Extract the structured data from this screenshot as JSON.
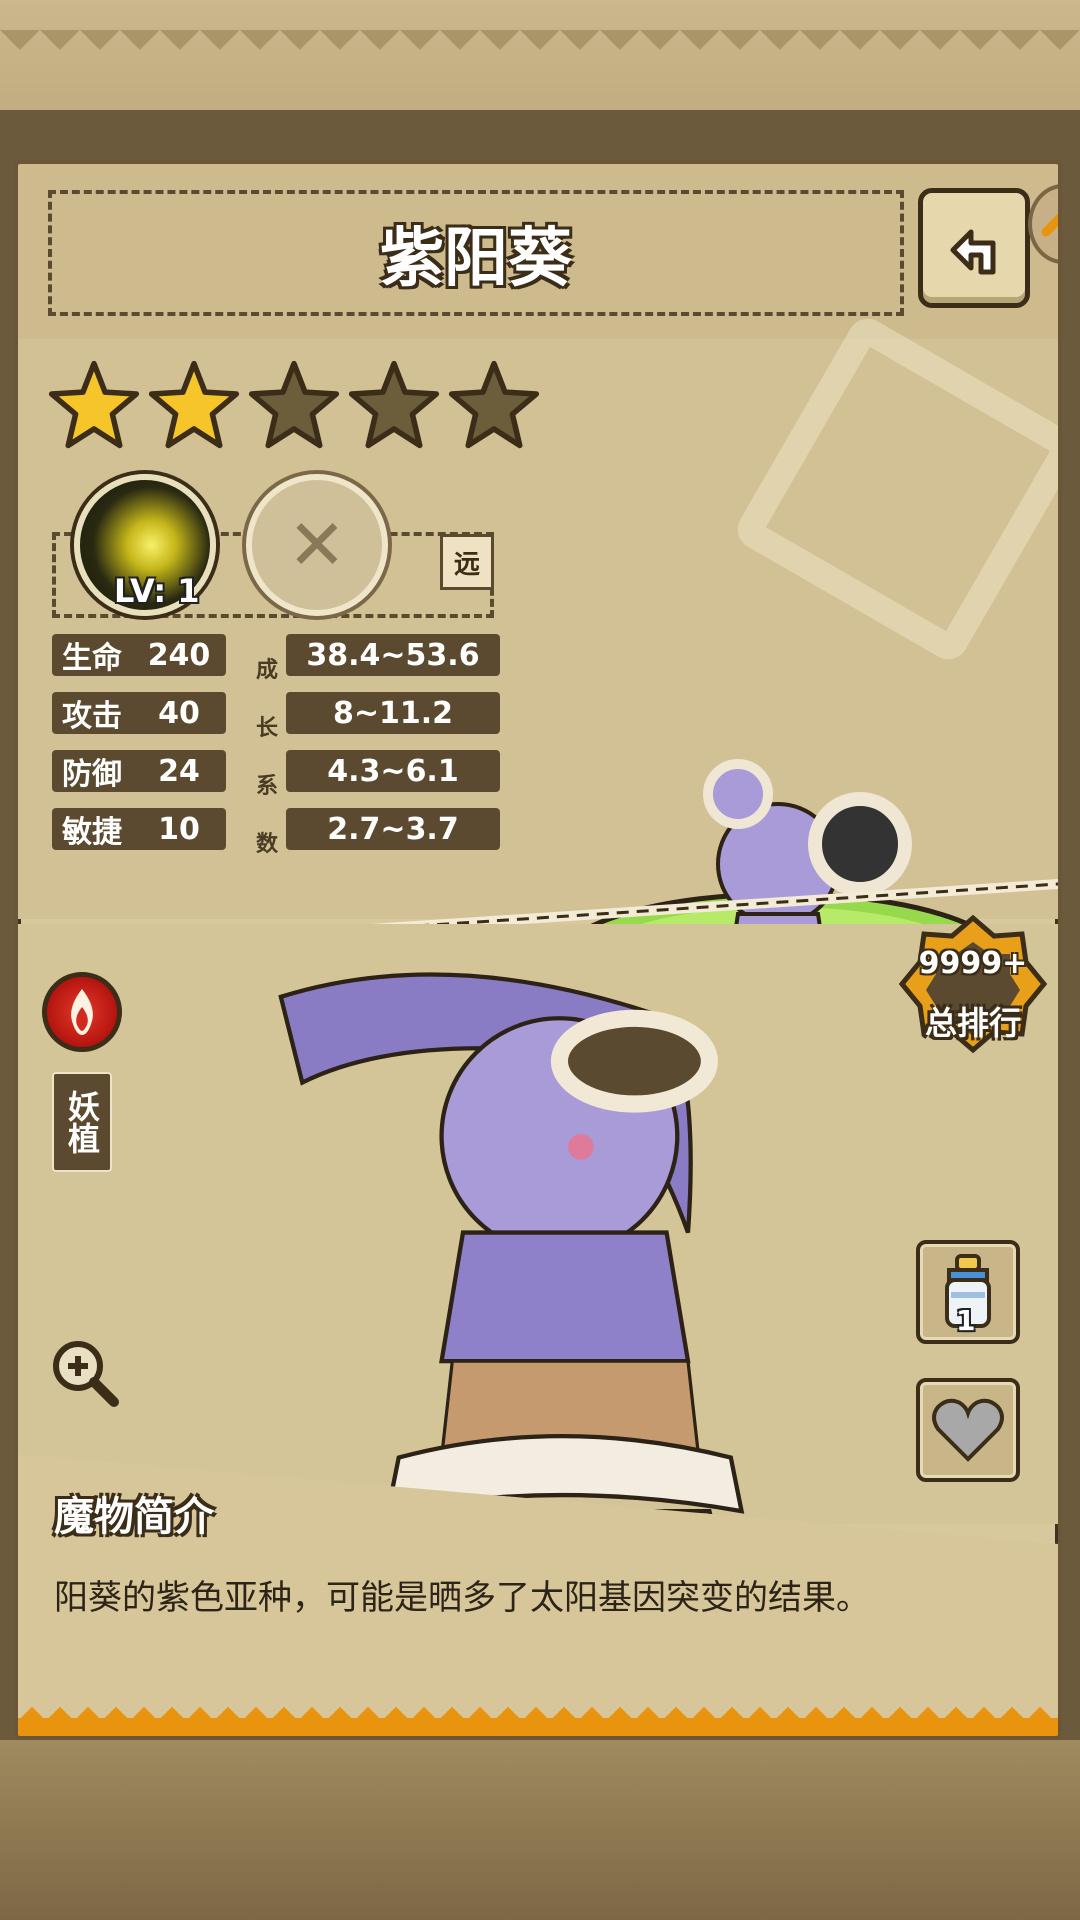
{
  "header": {
    "title": "紫阳葵"
  },
  "rating": {
    "filled_stars": 2,
    "total_stars": 5
  },
  "skill": {
    "level_label": "LV: 1",
    "attack_type": "远"
  },
  "stats": {
    "rows": [
      {
        "name": "生命",
        "value": "240",
        "growth": "38.4~53.6"
      },
      {
        "name": "攻击",
        "value": "40",
        "growth": "8~11.2"
      },
      {
        "name": "防御",
        "value": "24",
        "growth": "4.3~6.1"
      },
      {
        "name": "敏捷",
        "value": "10",
        "growth": "2.7~3.7"
      }
    ],
    "growth_label_chars": [
      "成",
      "长",
      "系",
      "数"
    ]
  },
  "monster": {
    "type_label": "妖植",
    "element_icon": "fire-icon"
  },
  "rank": {
    "value": "9999+",
    "label": "总排行"
  },
  "items": {
    "bottle_count": "1"
  },
  "description": {
    "heading": "魔物简介",
    "text": "阳葵的紫色亚种，可能是晒多了太阳基因突变的结果。"
  },
  "colors": {
    "panel_bg": "#d8c89e",
    "dark_brown": "#3b2d18",
    "stat_bg": "#5b4a30",
    "star_gold": "#f5c52a",
    "accent_orange": "#e9940f",
    "fire_red": "#d12a1e"
  }
}
